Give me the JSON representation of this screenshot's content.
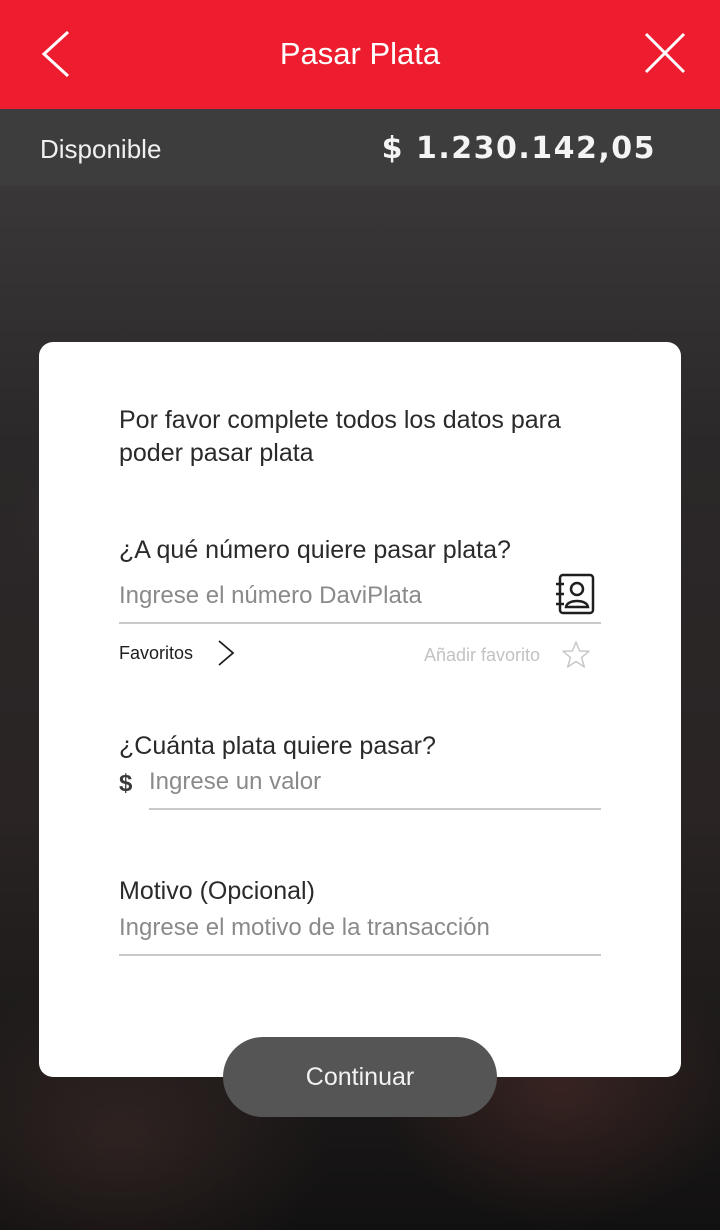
{
  "header": {
    "title": "Pasar Plata",
    "back_icon": "chevron-left-icon",
    "close_icon": "close-icon",
    "background_color": "#ed1c2e"
  },
  "balance": {
    "label": "Disponible",
    "value": "$ 1.230.142,05"
  },
  "form": {
    "intro_text": "Por favor complete todos los datos para poder pasar plata",
    "phone": {
      "label": "¿A qué número quiere pasar plata?",
      "placeholder": "Ingrese el número DaviPlata",
      "contacts_icon": "contacts-book-icon"
    },
    "favorites": {
      "label": "Favoritos",
      "add_label": "Añadir favorito",
      "star_icon": "star-icon"
    },
    "amount": {
      "label": "¿Cuánta plata quiere pasar?",
      "currency_symbol": "$",
      "placeholder": "Ingrese un valor"
    },
    "reason": {
      "label": "Motivo (Opcional)",
      "placeholder": "Ingrese el motivo de la transacción"
    }
  },
  "actions": {
    "continue_label": "Continuar"
  }
}
